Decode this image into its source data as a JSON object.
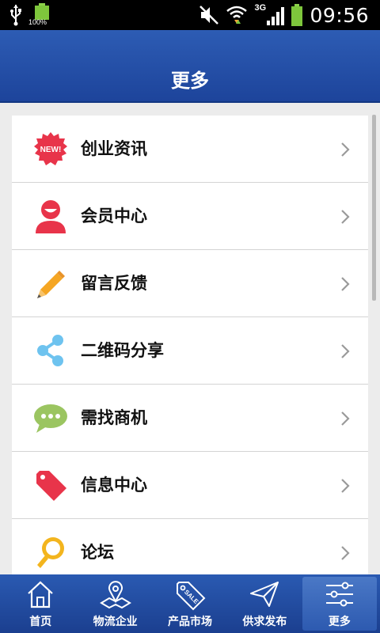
{
  "status_bar": {
    "battery_percent_label": "100%",
    "network_type": "3G",
    "time": "09:56"
  },
  "header": {
    "title": "更多"
  },
  "menu": {
    "items": [
      {
        "label": "创业资讯",
        "icon": "new-badge-icon"
      },
      {
        "label": "会员中心",
        "icon": "user-icon"
      },
      {
        "label": "留言反馈",
        "icon": "pencil-icon"
      },
      {
        "label": "二维码分享",
        "icon": "share-icon"
      },
      {
        "label": "需找商机",
        "icon": "chat-bubble-icon"
      },
      {
        "label": "信息中心",
        "icon": "tag-icon"
      },
      {
        "label": "论坛",
        "icon": "magnifier-icon"
      }
    ],
    "new_badge_text": "NEW!"
  },
  "tabbar": {
    "tabs": [
      {
        "label": "首页",
        "icon": "home-icon"
      },
      {
        "label": "物流企业",
        "icon": "map-pin-icon"
      },
      {
        "label": "产品市场",
        "icon": "sale-tag-icon",
        "badge": "SALE"
      },
      {
        "label": "供求发布",
        "icon": "paper-plane-icon"
      },
      {
        "label": "更多",
        "icon": "sliders-icon"
      }
    ],
    "active_index": 4
  },
  "colors": {
    "header_blue": "#2150a6",
    "tab_blue": "#1f4596",
    "icon_red": "#e8344a",
    "icon_orange": "#f5a623",
    "icon_lightblue": "#6ec3ef",
    "icon_green": "#9bc561",
    "icon_yellow": "#f3b51e"
  }
}
